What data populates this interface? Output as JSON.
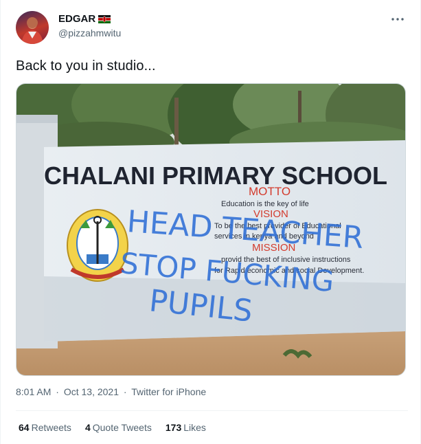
{
  "user": {
    "display_name": "EDGAR",
    "handle": "@pizzahmwitu",
    "flag_icon": "kenya-flag-icon"
  },
  "tweet": {
    "text": "Back to you in studio..."
  },
  "media": {
    "sign_title": "CHALANI PRIMARY SCHOOL",
    "motto_heading": "MOTTO",
    "motto_text": "Education is the key of life",
    "vision_heading": "VISION",
    "vision_line1": "To be the best provider of Educational",
    "vision_line2": "services in kenya and beyond",
    "mission_heading": "MISSION",
    "mission_line1": "provid the best of inclusive instructions",
    "mission_line2": "for Rapid economic and social Development.",
    "graffiti_line1": "HEAD TEACHER",
    "graffiti_line2": "STOP FUCKING",
    "graffiti_line3": "PUPILS"
  },
  "meta": {
    "time": "8:01 AM",
    "date": "Oct 13, 2021",
    "source": "Twitter for iPhone",
    "separator": "·"
  },
  "stats": {
    "retweets_count": "64",
    "retweets_label": "Retweets",
    "quotes_count": "4",
    "quotes_label": "Quote Tweets",
    "likes_count": "173",
    "likes_label": "Likes"
  },
  "colors": {
    "text_primary": "#0f1419",
    "text_secondary": "#536471",
    "divider": "#eff3f4",
    "graffiti": "#2f6fd6",
    "sign_red": "#d33a2c"
  }
}
